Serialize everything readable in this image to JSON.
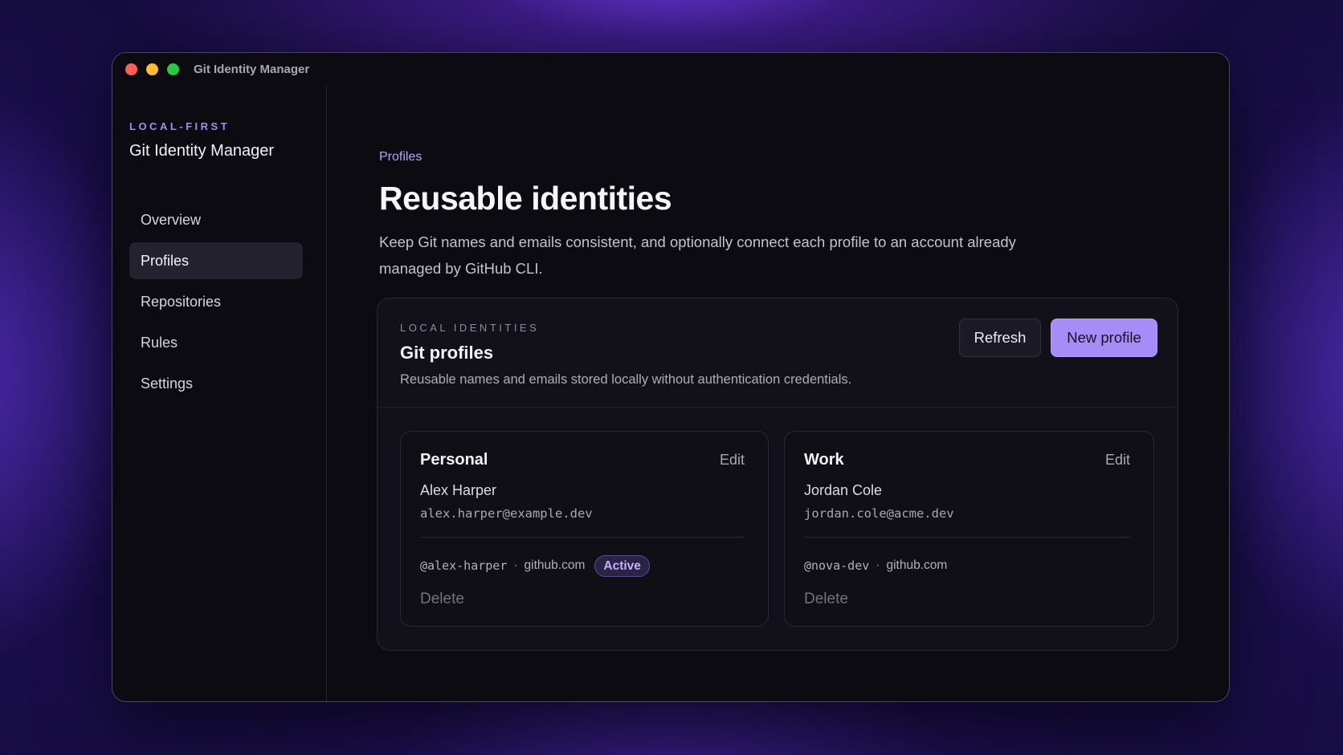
{
  "window": {
    "title": "Git Identity Manager"
  },
  "sidebar": {
    "eyebrow": "LOCAL-FIRST",
    "title": "Git Identity Manager",
    "items": [
      {
        "label": "Overview",
        "active": false
      },
      {
        "label": "Profiles",
        "active": true
      },
      {
        "label": "Repositories",
        "active": false
      },
      {
        "label": "Rules",
        "active": false
      },
      {
        "label": "Settings",
        "active": false
      }
    ]
  },
  "main": {
    "breadcrumb": "Profiles",
    "title": "Reusable identities",
    "description": "Keep Git names and emails consistent, and optionally connect each profile to an account already managed by GitHub CLI."
  },
  "card": {
    "eyebrow": "LOCAL IDENTITIES",
    "title": "Git profiles",
    "description": "Reusable names and emails stored locally without authentication credentials.",
    "refresh_label": "Refresh",
    "new_label": "New profile"
  },
  "profiles": [
    {
      "name": "Personal",
      "edit_label": "Edit",
      "person": "Alex Harper",
      "email": "alex.harper@example.dev",
      "handle": "@alex-harper",
      "separator": "·",
      "host": "github.com",
      "badge": "Active",
      "delete_label": "Delete"
    },
    {
      "name": "Work",
      "edit_label": "Edit",
      "person": "Jordan Cole",
      "email": "jordan.cole@acme.dev",
      "handle": "@nova-dev",
      "separator": "·",
      "host": "github.com",
      "delete_label": "Delete"
    }
  ],
  "colors": {
    "accent": "#a58cf7",
    "window_bg": "#0c0b12",
    "close": "#ff5f57",
    "minimize": "#febc2e",
    "maximize": "#28c840"
  }
}
